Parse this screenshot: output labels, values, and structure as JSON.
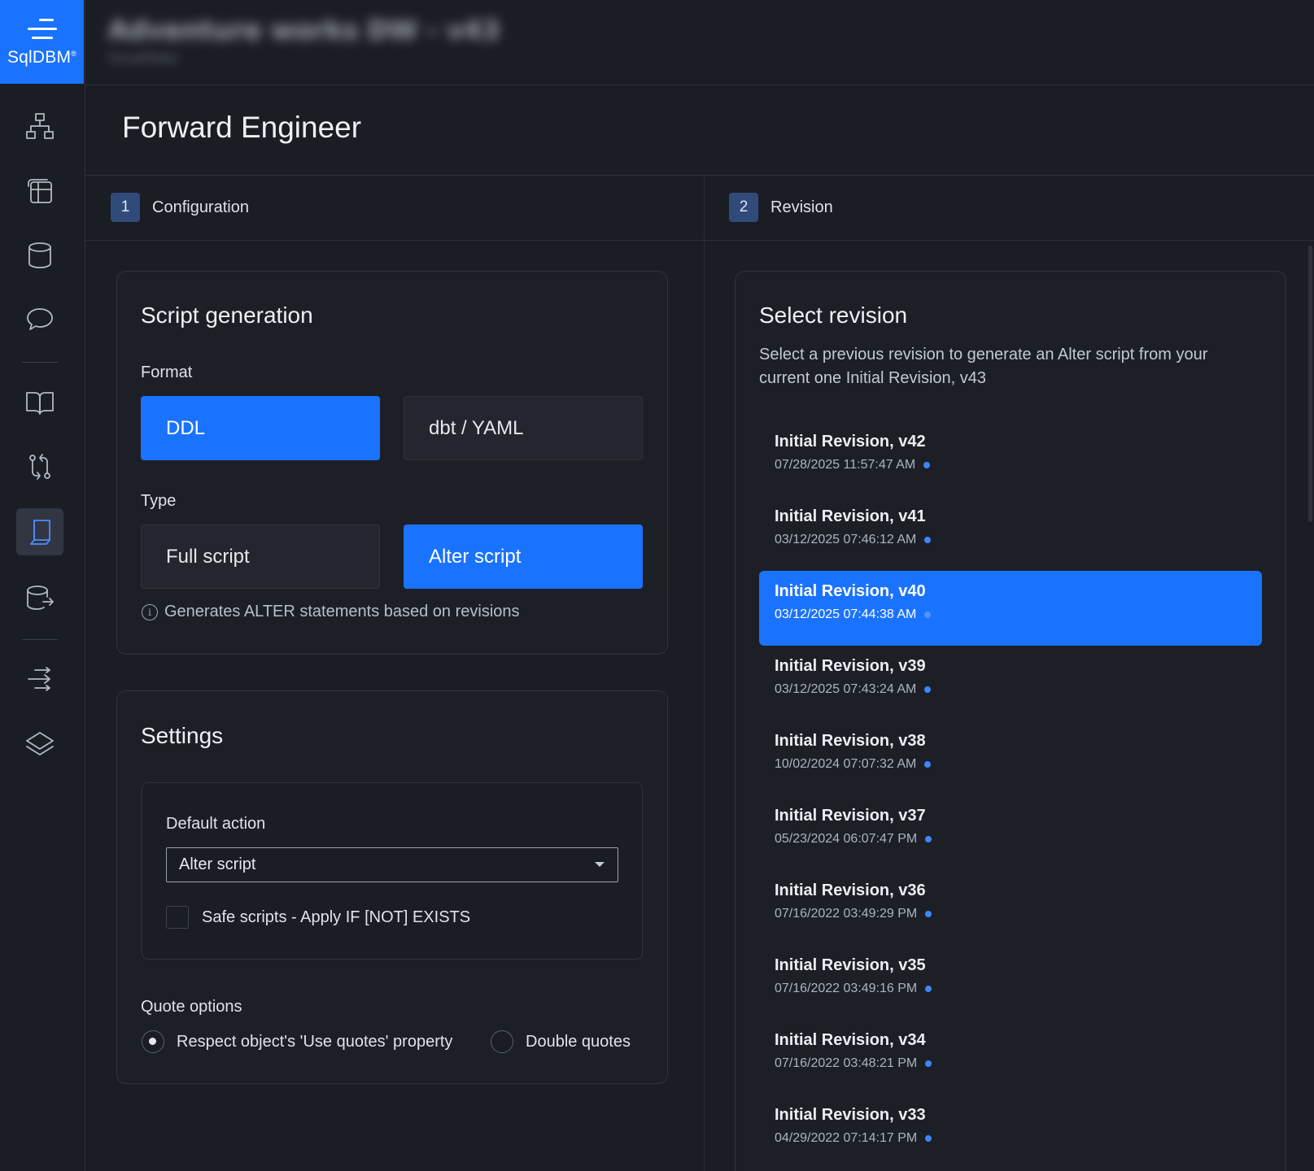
{
  "app": {
    "logo_text": "SqlDBM",
    "logo_mark": "®"
  },
  "header": {
    "project_title": "Adventure works DW - v43",
    "project_subtitle": "Snowflake"
  },
  "page": {
    "title": "Forward Engineer"
  },
  "steps": [
    {
      "number": "1",
      "label": "Configuration"
    },
    {
      "number": "2",
      "label": "Revision"
    }
  ],
  "script_generation": {
    "title": "Script generation",
    "format_label": "Format",
    "format_options": [
      "DDL",
      "dbt / YAML"
    ],
    "format_selected": "DDL",
    "type_label": "Type",
    "type_options": [
      "Full script",
      "Alter script"
    ],
    "type_selected": "Alter script",
    "hint": "Generates ALTER statements based on revisions"
  },
  "settings": {
    "title": "Settings",
    "default_action_label": "Default action",
    "default_action_value": "Alter script",
    "safe_scripts_label": "Safe scripts - Apply IF [NOT] EXISTS",
    "safe_scripts_checked": false,
    "quote_options_label": "Quote options",
    "quote_options": [
      "Respect object's 'Use quotes' property",
      "Double quotes"
    ],
    "quote_selected": "Respect object's 'Use quotes' property"
  },
  "revision": {
    "title": "Select revision",
    "description": "Select a previous revision to generate an Alter script from your current one Initial Revision, v43",
    "selected": "Initial Revision, v40",
    "items": [
      {
        "name": "Initial Revision, v42",
        "date": "07/28/2025 11:57:47 AM"
      },
      {
        "name": "Initial Revision, v41",
        "date": "03/12/2025 07:46:12 AM"
      },
      {
        "name": "Initial Revision, v40",
        "date": "03/12/2025 07:44:38 AM"
      },
      {
        "name": "Initial Revision, v39",
        "date": "03/12/2025 07:43:24 AM"
      },
      {
        "name": "Initial Revision, v38",
        "date": "10/02/2024 07:07:32 AM"
      },
      {
        "name": "Initial Revision, v37",
        "date": "05/23/2024 06:07:47 PM"
      },
      {
        "name": "Initial Revision, v36",
        "date": "07/16/2022 03:49:29 PM"
      },
      {
        "name": "Initial Revision, v35",
        "date": "07/16/2022 03:49:16 PM"
      },
      {
        "name": "Initial Revision, v34",
        "date": "07/16/2022 03:48:21 PM"
      },
      {
        "name": "Initial Revision, v33",
        "date": "04/29/2022 07:14:17 PM"
      }
    ]
  },
  "sidebar": {
    "items": [
      {
        "icon": "diagram-hierarchy-icon",
        "active": false
      },
      {
        "icon": "table-grid-icon",
        "active": false
      },
      {
        "icon": "database-icon",
        "active": false
      },
      {
        "icon": "chat-bubble-icon",
        "active": false
      },
      {
        "icon": "book-icon",
        "active": false
      },
      {
        "icon": "compare-arrows-icon",
        "active": false
      },
      {
        "icon": "forward-engineer-icon",
        "active": true
      },
      {
        "icon": "database-export-icon",
        "active": false
      },
      {
        "icon": "transfer-arrows-icon",
        "active": false
      },
      {
        "icon": "layers-icon",
        "active": false
      }
    ]
  },
  "colors": {
    "accent": "#1a73ff",
    "background": "#1b1d24",
    "step_badge": "#304a7a"
  }
}
